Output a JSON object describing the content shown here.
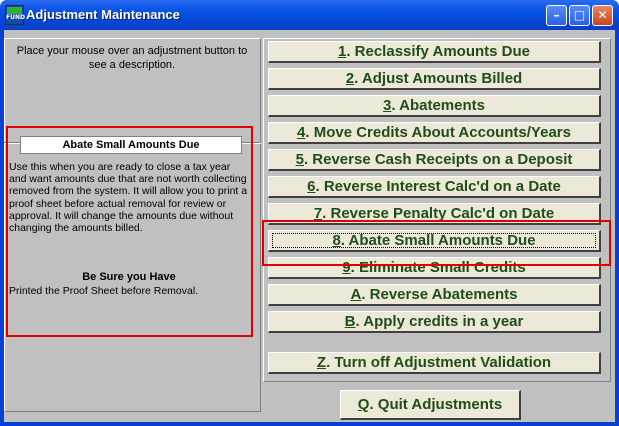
{
  "window": {
    "title": "Adjustment Maintenance",
    "icon_text": "FUND",
    "controls": {
      "minimize": "–",
      "maximize": "□",
      "close": "✕"
    }
  },
  "left": {
    "hint": "Place your mouse over an adjustment button to see a description.",
    "description_title": "Abate Small Amounts Due",
    "description_body": "Use this when you are ready to close a tax year and want amounts due that are not worth collecting removed from the system.  It will allow you to print a proof sheet before actual removal for review or approval. It will change the amounts due without changing the amounts billed.",
    "warning_heading": "Be Sure you Have",
    "warning_body": "Printed the Proof Sheet before Removal."
  },
  "buttons": [
    {
      "key": "1",
      "rest": ".  Reclassify Amounts Due"
    },
    {
      "key": "2",
      "rest": ". Adjust Amounts Billed"
    },
    {
      "key": "3",
      "rest": ". Abatements"
    },
    {
      "key": "4",
      "rest": ". Move Credits About Accounts/Years"
    },
    {
      "key": "5",
      "rest": ". Reverse Cash Receipts on a Deposit"
    },
    {
      "key": "6",
      "rest": ". Reverse Interest Calc'd on a Date"
    },
    {
      "key": "7",
      "rest": ". Reverse Penalty Calc'd on Date"
    },
    {
      "key": "8",
      "rest": ". Abate Small Amounts Due"
    },
    {
      "key": "9",
      "rest": ". Eliminate Small Credits"
    },
    {
      "key": "A",
      "rest": ". Reverse Abatements"
    },
    {
      "key": "B",
      "rest": ". Apply credits in a year"
    },
    {
      "key": "Z",
      "rest": ". Turn off Adjustment Validation"
    }
  ],
  "quit": {
    "key": "Q",
    "rest": ".  Quit Adjustments"
  },
  "colors": {
    "button_text": "#1f4e1a",
    "highlight": "#e00000",
    "titlebar": "#0b55e8"
  }
}
